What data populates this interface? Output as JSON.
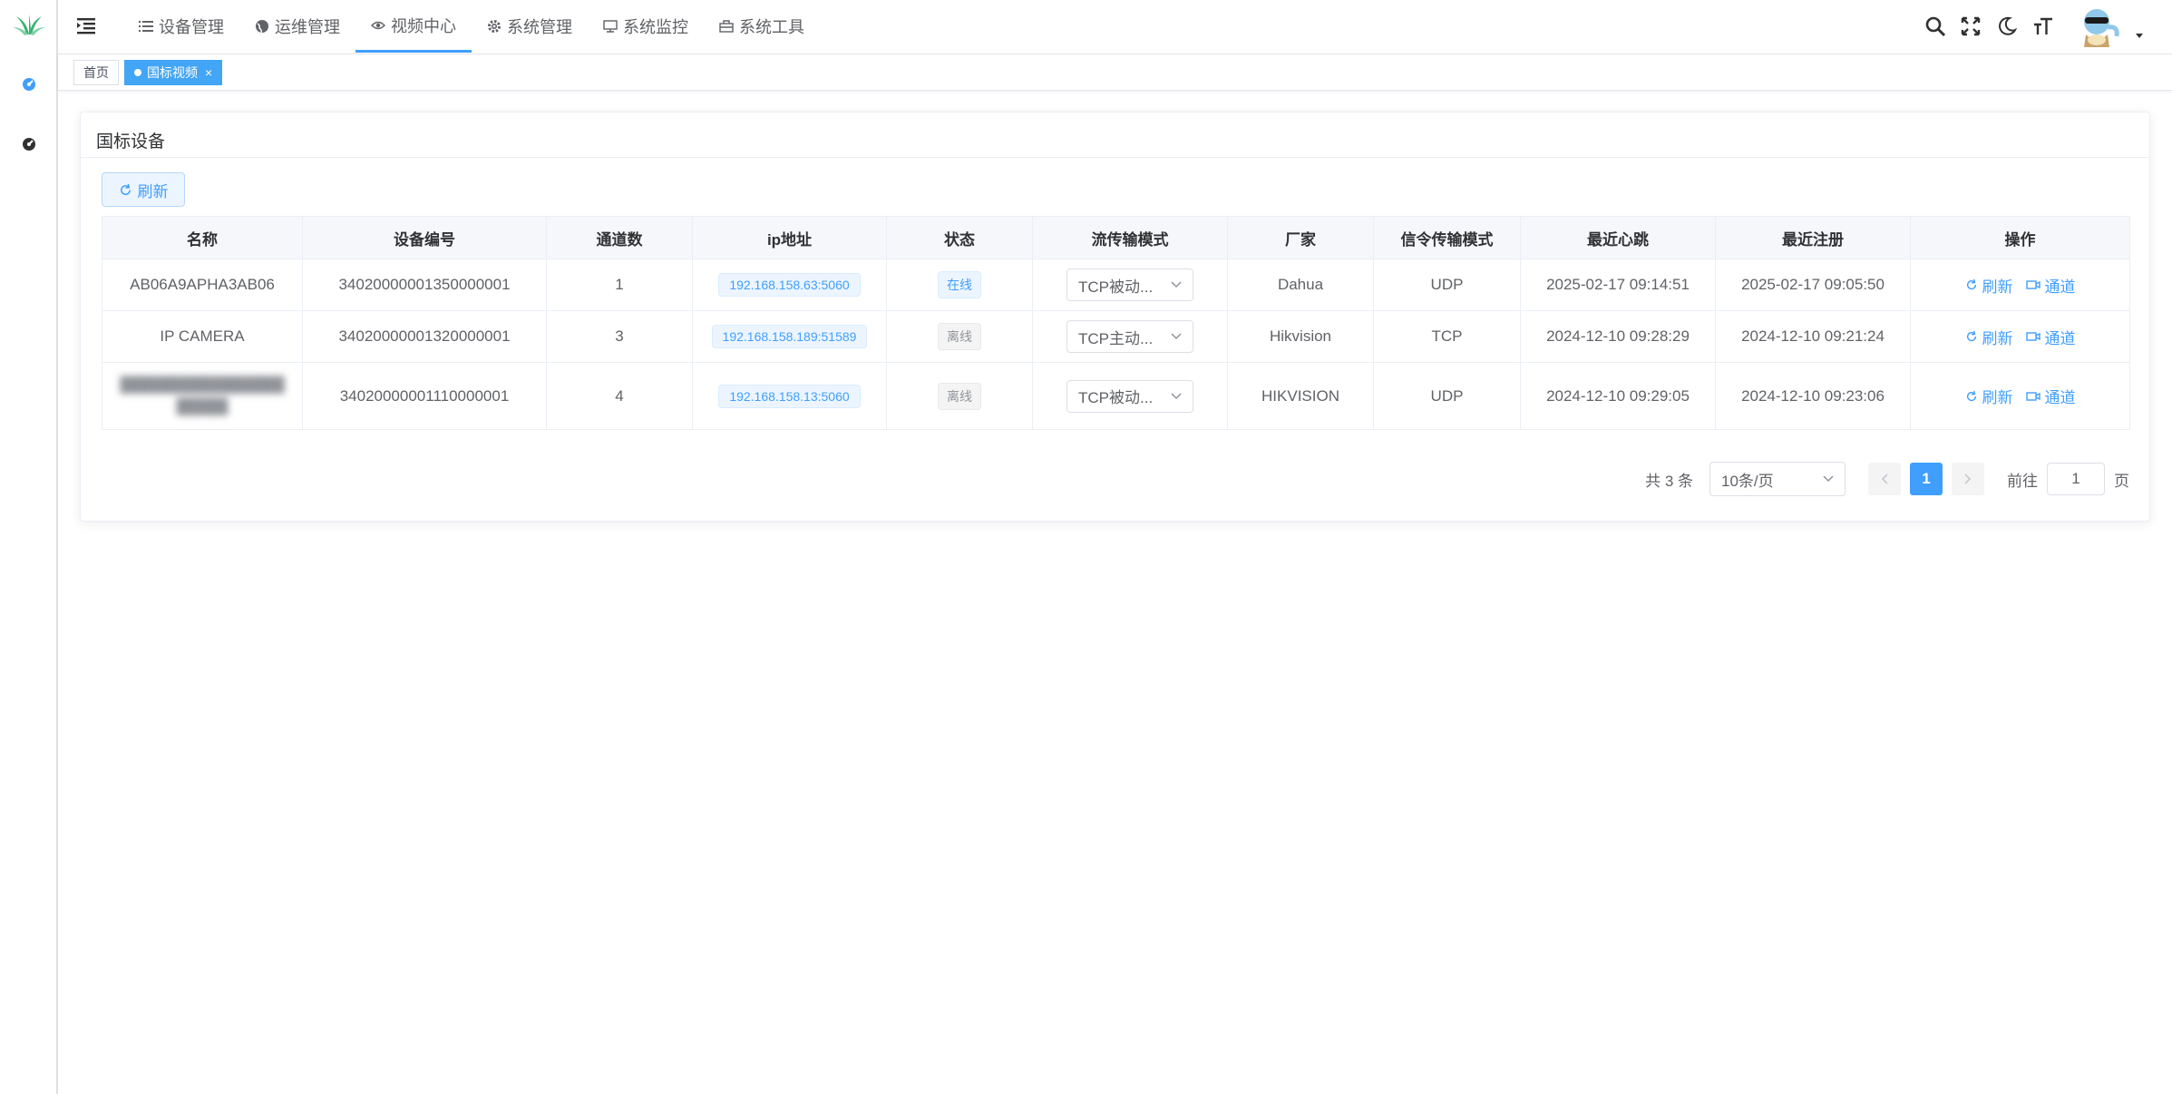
{
  "header": {
    "menu": [
      {
        "label": "设备管理",
        "icon": "list-icon"
      },
      {
        "label": "运维管理",
        "icon": "globe-icon"
      },
      {
        "label": "视频中心",
        "icon": "eye-icon",
        "active": true
      },
      {
        "label": "系统管理",
        "icon": "gear-icon"
      },
      {
        "label": "系统监控",
        "icon": "monitor-icon"
      },
      {
        "label": "系统工具",
        "icon": "toolbox-icon"
      }
    ]
  },
  "tags": {
    "home": "首页",
    "current": "国标视频",
    "close": "×"
  },
  "card": {
    "title": "国标设备",
    "refresh_label": "刷新"
  },
  "table": {
    "columns": [
      "名称",
      "设备编号",
      "通道数",
      "ip地址",
      "状态",
      "流传输模式",
      "厂家",
      "信令传输模式",
      "最近心跳",
      "最近注册",
      "操作"
    ],
    "rows": [
      {
        "name": "AB06A9APHA3AB06",
        "id": "34020000001350000001",
        "channels": "1",
        "ip": "192.168.158.63:5060",
        "status": "在线",
        "stream": "TCP被动...",
        "vendor": "Dahua",
        "signal": "UDP",
        "heartbeat": "2025-02-17 09:14:51",
        "register": "2025-02-17 09:05:50",
        "op_refresh": "刷新",
        "op_channel": "通道"
      },
      {
        "name": "IP CAMERA",
        "id": "34020000001320000001",
        "channels": "3",
        "ip": "192.168.158.189:51589",
        "status": "离线",
        "stream": "TCP主动...",
        "vendor": "Hikvision",
        "signal": "TCP",
        "heartbeat": "2024-12-10 09:28:29",
        "register": "2024-12-10 09:21:24",
        "op_refresh": "刷新",
        "op_channel": "通道"
      },
      {
        "name": "",
        "id": "34020000001110000001",
        "channels": "4",
        "ip": "192.168.158.13:5060",
        "status": "离线",
        "stream": "TCP被动...",
        "vendor": "HIKVISION",
        "signal": "UDP",
        "heartbeat": "2024-12-10 09:29:05",
        "register": "2024-12-10 09:23:06",
        "op_refresh": "刷新",
        "op_channel": "通道"
      }
    ]
  },
  "pagination": {
    "total": "共 3 条",
    "page_size": "10条/页",
    "current_page": "1",
    "goto_prefix": "前往",
    "goto_value": "1",
    "goto_suffix": "页"
  },
  "colors": {
    "accent": "#409eff",
    "tag_active": "#42a5f5",
    "logo": "#3bb273"
  }
}
